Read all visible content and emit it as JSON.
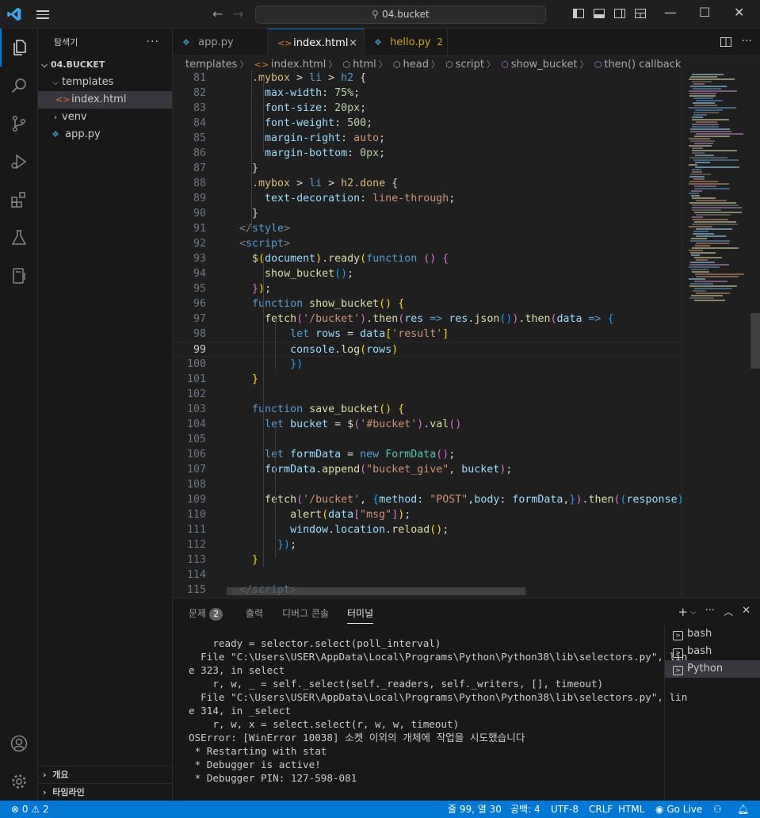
{
  "titlebar": {
    "search_text": "04.bucket",
    "window_controls": [
      "minimize",
      "maximize",
      "close"
    ]
  },
  "sidebar": {
    "title": "탐색기",
    "root_folder": "04.BUCKET",
    "items": [
      {
        "label": "templates",
        "type": "folder",
        "expanded": true
      },
      {
        "label": "index.html",
        "type": "html-file",
        "selected": true
      },
      {
        "label": "venv",
        "type": "folder",
        "expanded": false
      },
      {
        "label": "app.py",
        "type": "python-file"
      }
    ],
    "outline_label": "개요",
    "timeline_label": "타임라인"
  },
  "tabs": [
    {
      "label": "app.py",
      "icon": "python-icon",
      "active": false
    },
    {
      "label": "index.html",
      "icon": "html-icon",
      "active": true,
      "close": "×"
    },
    {
      "label": "hello.py",
      "icon": "python-icon",
      "active": false,
      "problems": "2"
    }
  ],
  "breadcrumb": [
    "templates",
    "index.html",
    "html",
    "head",
    "script",
    "show_bucket",
    "then() callback"
  ],
  "editor": {
    "current_line": 99,
    "line_numbers": [
      "81",
      "82",
      "83",
      "84",
      "85",
      "86",
      "87",
      "88",
      "89",
      "90",
      "91",
      "92",
      "93",
      "94",
      "95",
      "96",
      "97",
      "98",
      "99",
      "100",
      "101",
      "102",
      "103",
      "104",
      "105",
      "106",
      "107",
      "108",
      "109",
      "110",
      "111",
      "112",
      "113",
      "114",
      "115"
    ]
  },
  "panel": {
    "tabs": [
      {
        "label": "문제",
        "badge": "2"
      },
      {
        "label": "출력"
      },
      {
        "label": "디버그 콘솔"
      },
      {
        "label": "터미널",
        "active": true
      }
    ],
    "terminal_lines": [
      "    ready = selector.select(poll_interval)",
      "  File \"C:\\Users\\USER\\AppData\\Local\\Programs\\Python\\Python38\\lib\\selectors.py\", lin",
      "e 323, in select",
      "    r, w, _ = self._select(self._readers, self._writers, [], timeout)",
      "  File \"C:\\Users\\USER\\AppData\\Local\\Programs\\Python\\Python38\\lib\\selectors.py\", lin",
      "e 314, in _select",
      "    r, w, x = select.select(r, w, w, timeout)",
      "OSError: [WinError 10038] 소켓 이외의 개체에 작업을 시도했습니다",
      " * Restarting with stat",
      " * Debugger is active!",
      " * Debugger PIN: 127-598-081"
    ],
    "terminals": [
      {
        "label": "bash"
      },
      {
        "label": "bash"
      },
      {
        "label": "Python",
        "active": true
      }
    ]
  },
  "statusbar": {
    "errors": "0",
    "warnings": "2",
    "position": "줄 99, 열 30",
    "spaces": "공백: 4",
    "encoding": "UTF-8",
    "eol": "CRLF",
    "language": "HTML",
    "golive": "Go Live"
  },
  "colors": {
    "accent": "#0078d4",
    "statusbar": "#0078d4",
    "editor_bg": "#1f1f1f",
    "sidebar_bg": "#181818",
    "warning": "#cca700"
  }
}
